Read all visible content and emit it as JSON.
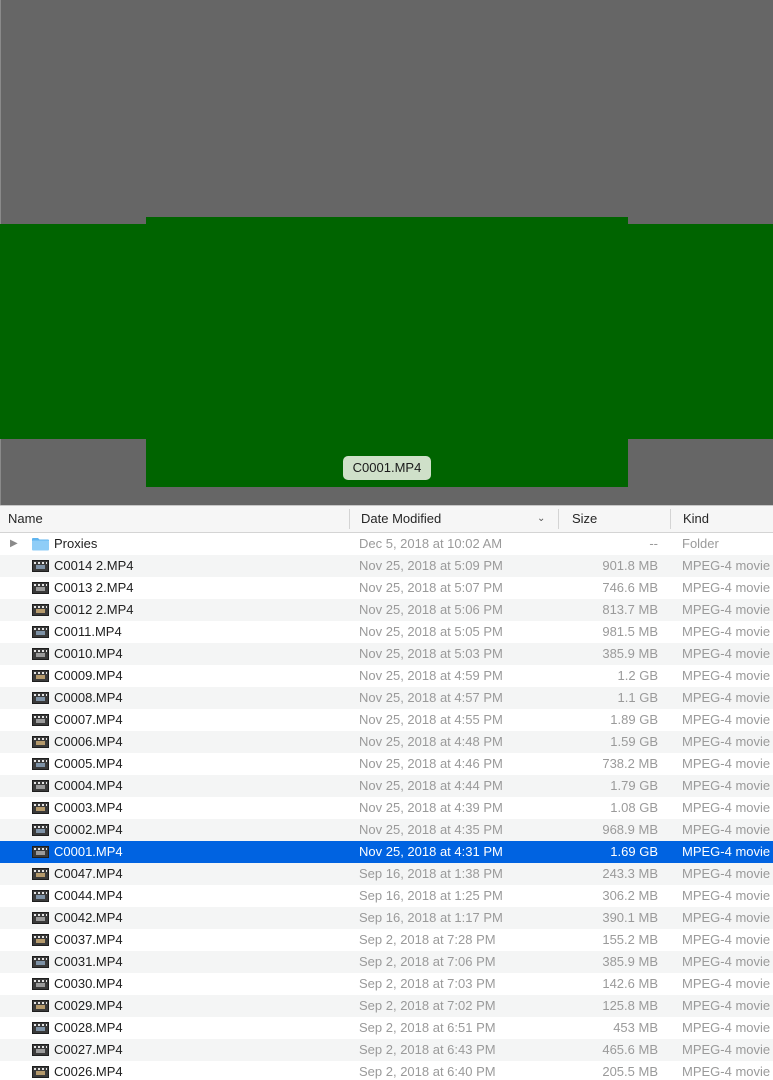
{
  "preview": {
    "caption": "C0001.MP4",
    "background_color": "#666666",
    "thumbnail_color": "#006400"
  },
  "columns": {
    "name": "Name",
    "date_modified": "Date Modified",
    "size": "Size",
    "kind": "Kind",
    "sort_indicator": "chevron-down-icon"
  },
  "rows": [
    {
      "name": "Proxies",
      "date": "Dec 5, 2018 at 10:02 AM",
      "size": "--",
      "kind": "Folder",
      "icon": "folder-icon"
    },
    {
      "name": "C0014 2.MP4",
      "date": "Nov 25, 2018 at 5:09 PM",
      "size": "901.8 MB",
      "kind": "MPEG-4 movie",
      "icon": "video-thumbnail-icon"
    },
    {
      "name": "C0013 2.MP4",
      "date": "Nov 25, 2018 at 5:07 PM",
      "size": "746.6 MB",
      "kind": "MPEG-4 movie",
      "icon": "video-thumbnail-icon"
    },
    {
      "name": "C0012 2.MP4",
      "date": "Nov 25, 2018 at 5:06 PM",
      "size": "813.7 MB",
      "kind": "MPEG-4 movie",
      "icon": "video-thumbnail-icon"
    },
    {
      "name": "C0011.MP4",
      "date": "Nov 25, 2018 at 5:05 PM",
      "size": "981.5 MB",
      "kind": "MPEG-4 movie",
      "icon": "video-thumbnail-icon"
    },
    {
      "name": "C0010.MP4",
      "date": "Nov 25, 2018 at 5:03 PM",
      "size": "385.9 MB",
      "kind": "MPEG-4 movie",
      "icon": "video-thumbnail-icon"
    },
    {
      "name": "C0009.MP4",
      "date": "Nov 25, 2018 at 4:59 PM",
      "size": "1.2 GB",
      "kind": "MPEG-4 movie",
      "icon": "video-thumbnail-icon"
    },
    {
      "name": "C0008.MP4",
      "date": "Nov 25, 2018 at 4:57 PM",
      "size": "1.1 GB",
      "kind": "MPEG-4 movie",
      "icon": "video-thumbnail-icon"
    },
    {
      "name": "C0007.MP4",
      "date": "Nov 25, 2018 at 4:55 PM",
      "size": "1.89 GB",
      "kind": "MPEG-4 movie",
      "icon": "video-thumbnail-icon"
    },
    {
      "name": "C0006.MP4",
      "date": "Nov 25, 2018 at 4:48 PM",
      "size": "1.59 GB",
      "kind": "MPEG-4 movie",
      "icon": "video-thumbnail-icon"
    },
    {
      "name": "C0005.MP4",
      "date": "Nov 25, 2018 at 4:46 PM",
      "size": "738.2 MB",
      "kind": "MPEG-4 movie",
      "icon": "video-thumbnail-icon"
    },
    {
      "name": "C0004.MP4",
      "date": "Nov 25, 2018 at 4:44 PM",
      "size": "1.79 GB",
      "kind": "MPEG-4 movie",
      "icon": "video-thumbnail-icon"
    },
    {
      "name": "C0003.MP4",
      "date": "Nov 25, 2018 at 4:39 PM",
      "size": "1.08 GB",
      "kind": "MPEG-4 movie",
      "icon": "video-thumbnail-icon"
    },
    {
      "name": "C0002.MP4",
      "date": "Nov 25, 2018 at 4:35 PM",
      "size": "968.9 MB",
      "kind": "MPEG-4 movie",
      "icon": "video-thumbnail-icon"
    },
    {
      "name": "C0001.MP4",
      "date": "Nov 25, 2018 at 4:31 PM",
      "size": "1.69 GB",
      "kind": "MPEG-4 movie",
      "icon": "video-thumbnail-icon",
      "selected": true
    },
    {
      "name": "C0047.MP4",
      "date": "Sep 16, 2018 at 1:38 PM",
      "size": "243.3 MB",
      "kind": "MPEG-4 movie",
      "icon": "video-thumbnail-icon"
    },
    {
      "name": "C0044.MP4",
      "date": "Sep 16, 2018 at 1:25 PM",
      "size": "306.2 MB",
      "kind": "MPEG-4 movie",
      "icon": "video-thumbnail-icon"
    },
    {
      "name": "C0042.MP4",
      "date": "Sep 16, 2018 at 1:17 PM",
      "size": "390.1 MB",
      "kind": "MPEG-4 movie",
      "icon": "video-thumbnail-icon"
    },
    {
      "name": "C0037.MP4",
      "date": "Sep 2, 2018 at 7:28 PM",
      "size": "155.2 MB",
      "kind": "MPEG-4 movie",
      "icon": "video-thumbnail-icon"
    },
    {
      "name": "C0031.MP4",
      "date": "Sep 2, 2018 at 7:06 PM",
      "size": "385.9 MB",
      "kind": "MPEG-4 movie",
      "icon": "video-thumbnail-icon"
    },
    {
      "name": "C0030.MP4",
      "date": "Sep 2, 2018 at 7:03 PM",
      "size": "142.6 MB",
      "kind": "MPEG-4 movie",
      "icon": "video-thumbnail-icon"
    },
    {
      "name": "C0029.MP4",
      "date": "Sep 2, 2018 at 7:02 PM",
      "size": "125.8 MB",
      "kind": "MPEG-4 movie",
      "icon": "video-thumbnail-icon"
    },
    {
      "name": "C0028.MP4",
      "date": "Sep 2, 2018 at 6:51 PM",
      "size": "453 MB",
      "kind": "MPEG-4 movie",
      "icon": "video-thumbnail-icon"
    },
    {
      "name": "C0027.MP4",
      "date": "Sep 2, 2018 at 6:43 PM",
      "size": "465.6 MB",
      "kind": "MPEG-4 movie",
      "icon": "video-thumbnail-icon"
    },
    {
      "name": "C0026.MP4",
      "date": "Sep 2, 2018 at 6:40 PM",
      "size": "205.5 MB",
      "kind": "MPEG-4 movie",
      "icon": "video-thumbnail-icon"
    }
  ]
}
